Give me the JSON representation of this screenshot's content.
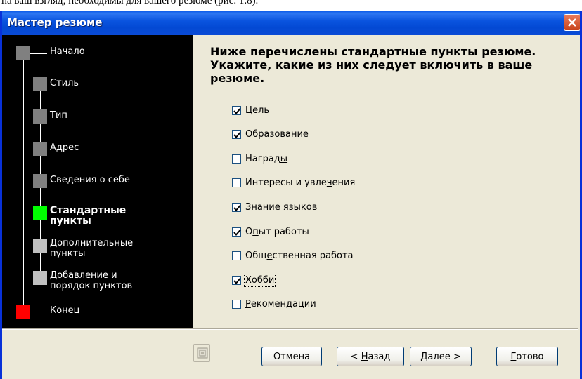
{
  "document_fragment": "на ваш взгляд, необходимы для вашего резюме (рис. 1.8).",
  "window": {
    "title": "Мастер резюме"
  },
  "steps": [
    {
      "label": "Начало",
      "color": "#808080",
      "current": false
    },
    {
      "label": "Стиль",
      "color": "#808080",
      "current": false
    },
    {
      "label": "Тип",
      "color": "#808080",
      "current": false
    },
    {
      "label": "Адрес",
      "color": "#808080",
      "current": false
    },
    {
      "label": "Сведения о себе",
      "color": "#808080",
      "current": false
    },
    {
      "label": "Стандартные\nпункты",
      "color": "#00ff00",
      "current": true
    },
    {
      "label": "Дополнительные\nпункты",
      "color": "#c0c0c0",
      "current": false
    },
    {
      "label": "Добавление и\nпорядок пунктов",
      "color": "#c0c0c0",
      "current": false
    },
    {
      "label": "Конец",
      "color": "#ff0000",
      "current": false
    }
  ],
  "heading": "Ниже перечислены стандартные пункты резюме.  Укажите, какие из них следует включить в ваше резюме.",
  "checkboxes": [
    {
      "pre": "",
      "key": "Ц",
      "post": "ель",
      "checked": true
    },
    {
      "pre": "О",
      "key": "б",
      "post": "разование",
      "checked": true
    },
    {
      "pre": "Наград",
      "key": "ы",
      "post": "",
      "checked": false
    },
    {
      "pre": "Интересы и увле",
      "key": "ч",
      "post": "ения",
      "checked": false
    },
    {
      "pre": "Знание ",
      "key": "я",
      "post": "зыков",
      "checked": true
    },
    {
      "pre": "О",
      "key": "п",
      "post": "ыт работы",
      "checked": true
    },
    {
      "pre": "Общ",
      "key": "е",
      "post": "ственная работа",
      "checked": false
    },
    {
      "pre": "",
      "key": "Х",
      "post": "обби",
      "checked": true,
      "focused": true
    },
    {
      "pre": "",
      "key": "Р",
      "post": "екомендации",
      "checked": false
    }
  ],
  "buttons": {
    "cancel": {
      "label": "Отмена"
    },
    "back": {
      "pre": "< ",
      "key": "Н",
      "post": "азад"
    },
    "next": {
      "pre": "",
      "key": "Д",
      "post": "алее >"
    },
    "finish": {
      "pre": "",
      "key": "Г",
      "post": "отово"
    }
  }
}
